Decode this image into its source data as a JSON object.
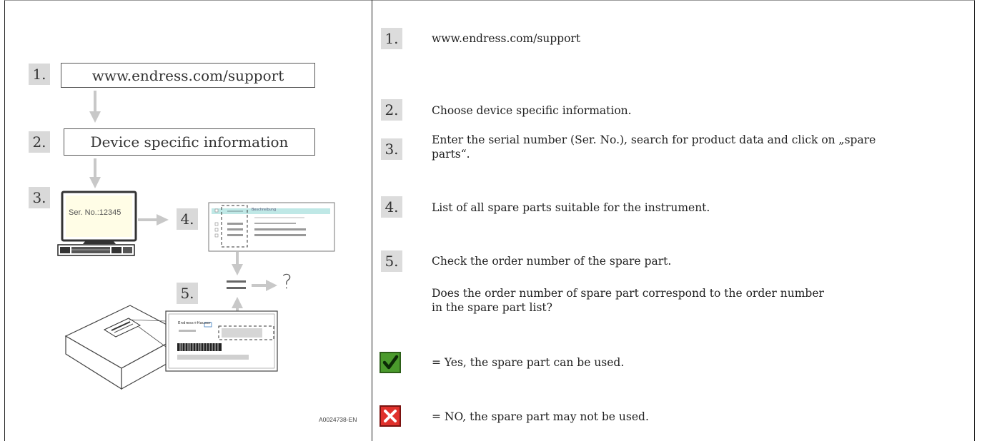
{
  "figure": {
    "step_numbers": [
      "1.",
      "2.",
      "3.",
      "4.",
      "5."
    ],
    "box1_text": "www.endress.com/support",
    "box2_text": "Device specific information",
    "monitor_text": "Ser. No.:12345",
    "list_header_label": "Beschreibung",
    "result_symbol": "?",
    "equals_symbol": "=",
    "nameplate_brand": "Endress+Hauser",
    "figure_id": "A0024738-EN"
  },
  "steps": [
    {
      "number": "1.",
      "text": "www.endress.com/support"
    },
    {
      "number": "2.",
      "text": "Choose device specific information."
    },
    {
      "number": "3.",
      "text": "Enter the serial number (Ser. No.), search for product data and click on „spare parts“."
    },
    {
      "number": "4.",
      "text": "List of all spare parts suitable for the instrument."
    },
    {
      "number": "5.",
      "text": "Check the order number of the spare part."
    }
  ],
  "question": "Does the order number of spare part correspond to the order number in the spare part list?",
  "answers": {
    "yes": "= Yes, the spare part can be used.",
    "no": "= NO, the spare part may not be used."
  },
  "icons": {
    "yes_icon": "checkmark-icon",
    "no_icon": "cross-icon"
  },
  "colors": {
    "yes_green": "#4a9a2c",
    "no_red": "#e0312c",
    "number_box_grey": "#d9d9d9",
    "list_header_teal": "#bfe8e6"
  }
}
